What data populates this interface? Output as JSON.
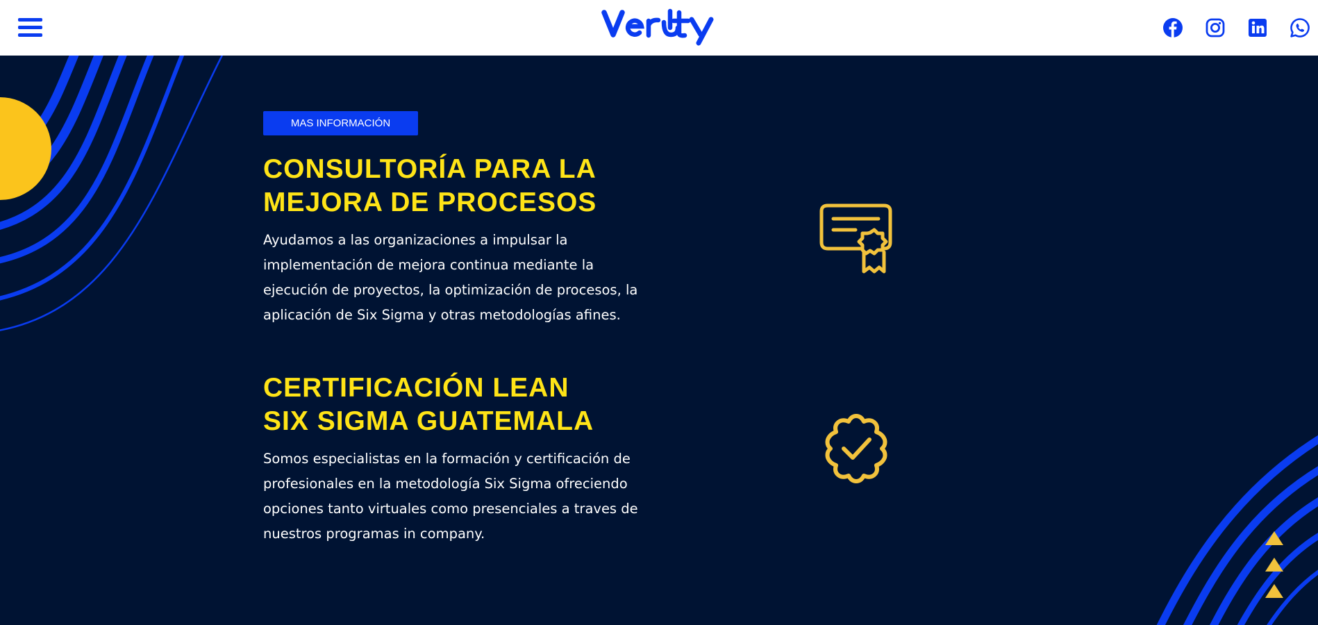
{
  "header": {
    "logo_text": "Verity",
    "menu_icon": "hamburger-menu-icon",
    "social": [
      {
        "name": "facebook-icon"
      },
      {
        "name": "instagram-icon"
      },
      {
        "name": "linkedin-icon"
      },
      {
        "name": "whatsapp-icon"
      }
    ]
  },
  "hero": {
    "cta_label": "MAS INFORMACIÓN",
    "sections": [
      {
        "title_line1": "CONSULTORÍA PARA LA",
        "title_line2": "MEJORA DE PROCESOS",
        "body": "Ayudamos a las organizaciones a impulsar la implementación de mejora continua mediante la ejecución de proyectos, la optimización de procesos, la aplicación de Six Sigma y otras metodologías afines.",
        "icon": "certificate-icon"
      },
      {
        "title_line1": "CERTIFICACIÓN LEAN",
        "title_line2": "SIX SIGMA GUATEMALA",
        "body": "Somos especialistas en la formación y certificación de profesionales en la metodología Six Sigma ofreciendo opciones tanto virtuales como presenciales a traves de nuestros programas in company.",
        "icon": "verified-badge-icon"
      }
    ]
  },
  "colors": {
    "brand_blue": "#0a3cf0",
    "background_navy": "#001333",
    "heading_yellow": "#ffe417",
    "icon_gold": "#f2c23c",
    "sun_yellow": "#fbc41c"
  }
}
